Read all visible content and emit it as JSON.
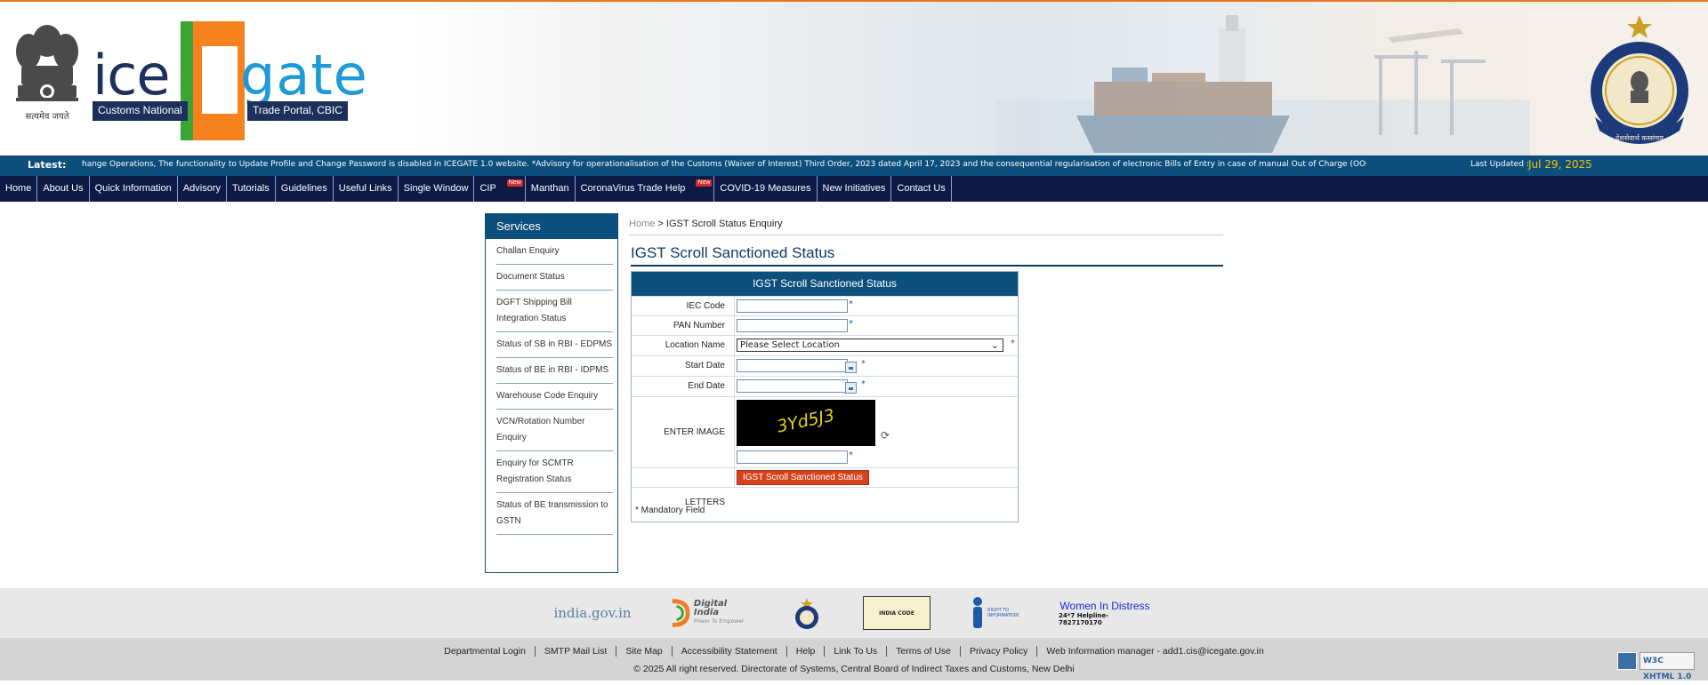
{
  "header": {
    "emblem_motto": "सत्यमेव जयते",
    "logo_ice": "ice",
    "logo_gate": "gate",
    "logo_sub_left": "Customs National",
    "logo_sub_right": "Trade Portal, CBIC",
    "seal_text": "देशसेवार्थ कस्संचय"
  },
  "ticker": {
    "label": "Latest:",
    "text": "hange Operations, The functionality to Update Profile and Change Password is disabled in ICEGATE 1.0 website. *Advisory for operationalisation of the Customs (Waiver of Interest) Third Order, 2023 dated April 17, 2023 and the consequential regularisation of electronic Bills of Entry in case of manual Out of Charge (OOC) given in the w",
    "last_updated_label": "Last Updated :",
    "last_updated_date": "Jul 29, 2025"
  },
  "nav": {
    "items": [
      {
        "label": "Home"
      },
      {
        "label": "About Us"
      },
      {
        "label": "Quick Information"
      },
      {
        "label": "Advisory"
      },
      {
        "label": "Tutorials"
      },
      {
        "label": "Guidelines"
      },
      {
        "label": "Useful Links"
      },
      {
        "label": "Single Window"
      },
      {
        "label": "CIP",
        "badge": "New"
      },
      {
        "label": "Manthan"
      },
      {
        "label": "CoronaVirus Trade Help",
        "badge": "New"
      },
      {
        "label": "COVID-19 Measures"
      },
      {
        "label": "New Initiatives"
      },
      {
        "label": "Contact Us"
      }
    ]
  },
  "sidebar": {
    "title": "Services",
    "items": [
      {
        "label": "Challan Enquiry"
      },
      {
        "label": "Document Status"
      },
      {
        "label": "DGFT Shipping Bill Integration Status"
      },
      {
        "label": "Status of SB in RBI - EDPMS"
      },
      {
        "label": "Status of BE in RBI - IDPMS"
      },
      {
        "label": "Warehouse Code Enquiry"
      },
      {
        "label": "VCN/Rotation Number Enquiry"
      },
      {
        "label": "Enquiry for SCMTR Registration Status"
      },
      {
        "label": "Status of BE transmission to GSTN"
      }
    ]
  },
  "breadcrumb": {
    "home": "Home",
    "sep": " > ",
    "current": "IGST Scroll Status Enquiry"
  },
  "page": {
    "title": "IGST Scroll Sanctioned Status"
  },
  "form": {
    "heading": "IGST Scroll Sanctioned Status",
    "required_mark": "*",
    "iec_label": "IEC Code",
    "iec_value": "",
    "pan_label": "PAN Number",
    "pan_value": "",
    "location_label": "Location Name",
    "location_selected": "Please Select Location",
    "start_date_label": "Start Date",
    "start_date_value": "",
    "end_date_label": "End Date",
    "end_date_value": "",
    "captcha_label": "ENTER IMAGE LETTERS",
    "captcha_text": "3Yd5J3",
    "captcha_value": "",
    "submit_label": "IGST Scroll Sanctioned Status",
    "mandatory_note": "* Mandatory Field"
  },
  "footer": {
    "logos": {
      "india_gov": "india.gov.in",
      "digital_india": "Digital India",
      "digital_india_tag": "Power To Empower",
      "india_code": "INDIA CODE",
      "rti": "RIGHT TO INFORMATION",
      "women_title": "Women In Distress",
      "women_helpline": "24*7 Helpline-7827170170"
    },
    "links": [
      {
        "label": "Departmental Login"
      },
      {
        "label": "SMTP Mail List"
      },
      {
        "label": "Site Map"
      },
      {
        "label": "Accessibility Statement"
      },
      {
        "label": "Help"
      },
      {
        "label": "Link To Us"
      },
      {
        "label": "Terms of Use"
      },
      {
        "label": "Privacy Policy"
      },
      {
        "label": "Web Information manager - add1.cis@icegate.gov.in"
      }
    ],
    "copyright": "© 2025 All right reserved. Directorate of Systems, Central Board of Indirect Taxes and Customs, New Delhi",
    "badge_w3c": "W3C XHTML 1.0"
  }
}
